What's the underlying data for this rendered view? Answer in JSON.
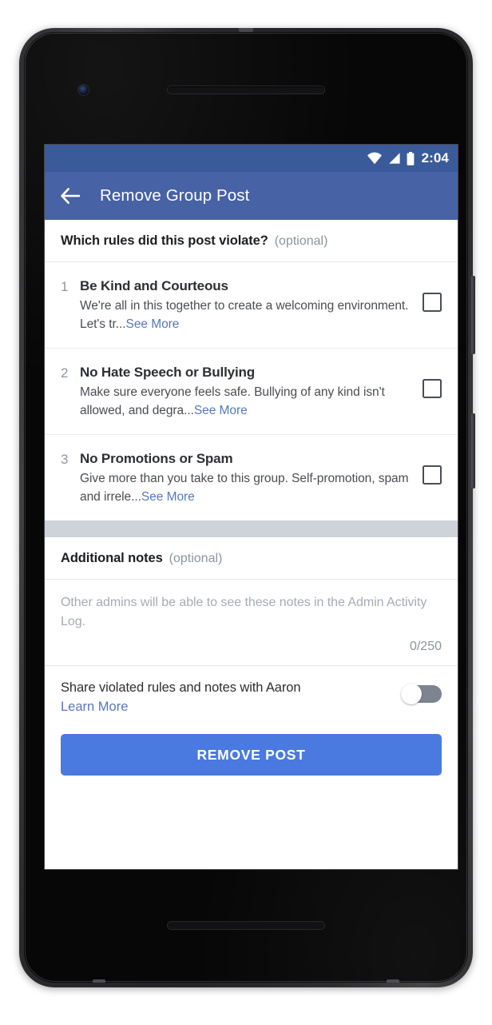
{
  "status_bar": {
    "time": "2:04",
    "icons": [
      "wifi-icon",
      "cell-signal-icon",
      "battery-icon"
    ]
  },
  "app_bar": {
    "back_icon": "back-arrow-icon",
    "title": "Remove Group Post"
  },
  "rules_section": {
    "header_title": "Which rules did this post violate?",
    "header_optional": "(optional)",
    "rules": [
      {
        "index": "1",
        "title": "Be Kind and Courteous",
        "description": "We're all in this together to create a welcoming environment. Let's tr...",
        "see_more": "See More",
        "checked": false
      },
      {
        "index": "2",
        "title": "No Hate Speech or Bullying",
        "description": "Make sure everyone feels safe. Bullying of any kind isn't allowed, and degra...",
        "see_more": "See More",
        "checked": false
      },
      {
        "index": "3",
        "title": "No Promotions or Spam",
        "description": "Give more than you take to this group. Self-promotion, spam and irrele...",
        "see_more": "See More",
        "checked": false
      }
    ]
  },
  "notes_section": {
    "header_title": "Additional notes",
    "header_optional": "(optional)",
    "placeholder": "Other admins will be able to see these notes in the Admin Activity Log.",
    "value": "",
    "counter": "0/250"
  },
  "share_section": {
    "label": "Share violated rules and notes with Aaron",
    "learn_more": "Learn More",
    "toggle_on": false
  },
  "footer": {
    "remove_post_label": "REMOVE POST"
  },
  "colors": {
    "status_bar": "#3b5a9a",
    "app_bar": "#4762a5",
    "primary_button": "#4a7ae0",
    "link": "#5878b9",
    "divider_band": "#ced2d9",
    "toggle_track_off": "#7d838f"
  }
}
